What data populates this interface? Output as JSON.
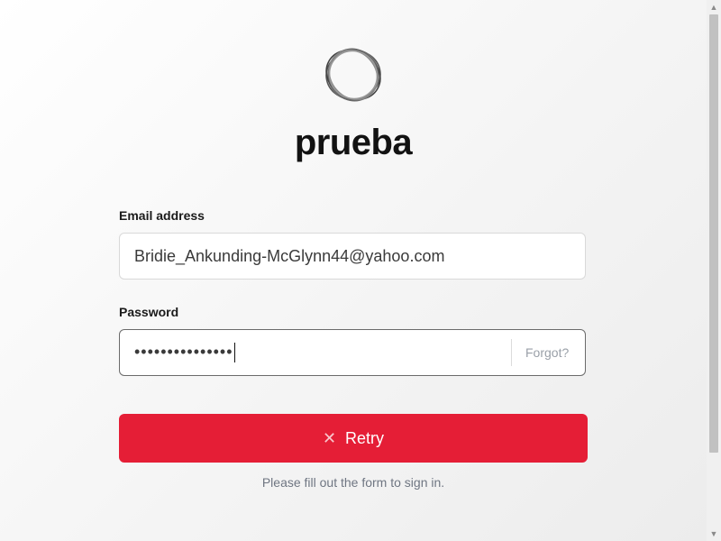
{
  "app": {
    "title": "prueba",
    "logo_icon": "ring-logo-icon"
  },
  "form": {
    "email": {
      "label": "Email address",
      "value": "Bridie_Ankunding-McGlynn44@yahoo.com"
    },
    "password": {
      "label": "Password",
      "masked_value": "•••••••••••••••",
      "forgot_label": "Forgot?"
    },
    "submit": {
      "label": "Retry",
      "icon": "close-icon",
      "color": "#e51e36"
    },
    "status": "Please fill out the form to sign in."
  },
  "scrollbar": {
    "up_icon": "scroll-up-arrow-icon",
    "down_icon": "scroll-down-arrow-icon"
  }
}
